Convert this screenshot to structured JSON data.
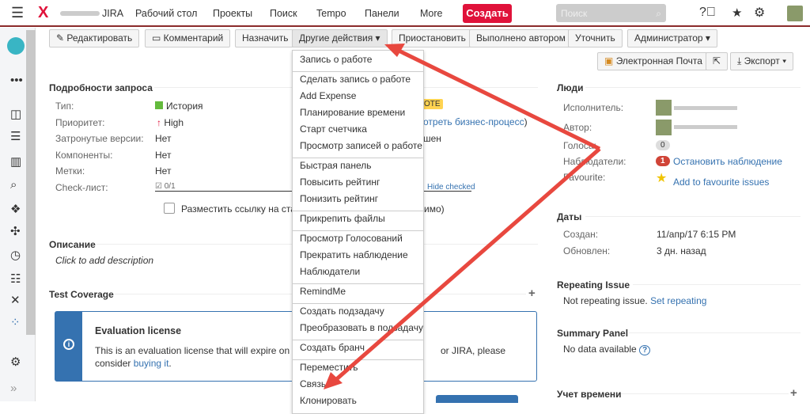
{
  "header": {
    "app": "JIRA",
    "nav": [
      "Рабочий стол",
      "Проекты",
      "Поиск",
      "Tempo",
      "Панели",
      "More"
    ],
    "create": "Создать",
    "search_placeholder": "Поиск"
  },
  "toolbar": {
    "edit": "Редактировать",
    "comment": "Комментарий",
    "assign": "Назначить",
    "more": "Другие действия",
    "pause": "Приостановить",
    "done_by_author": "Выполнено автором",
    "clarify": "Уточнить",
    "admin": "Администратор",
    "email": "Электронная Почта",
    "export": "Экспорт"
  },
  "details": {
    "title": "Подробности запроса",
    "rows": [
      {
        "label": "Тип:",
        "value": "История"
      },
      {
        "label": "Приоритет:",
        "value": "High"
      },
      {
        "label": "Затронутые версии:",
        "value": "Нет"
      },
      {
        "label": "Компоненты:",
        "value": "Нет"
      },
      {
        "label": "Метки:",
        "value": "Нет"
      },
      {
        "label": "Check-лист:",
        "value": "0/1"
      }
    ],
    "status_badge": "OTE",
    "workflow_link": "отреть бизнес-процесс",
    "workflow_paren": ")",
    "resolution": "шен",
    "hide_checked": "Hide checked",
    "checkbox_label": "Разместить ссылку на стат",
    "checkbox_tail": "имо)"
  },
  "description": {
    "title": "Описание",
    "placeholder": "Click to add description"
  },
  "test_coverage": {
    "title": "Test Coverage",
    "license_title": "Evaluation license",
    "license_text": "This is an evaluation license that will expire on 20",
    "license_text2": "or JIRA, please",
    "license_text3": "consider ",
    "buy_link": "buying it",
    "period": "."
  },
  "menu": {
    "groups": [
      [
        "Запись о работе"
      ],
      [
        "Сделать запись о работе",
        "Add Expense",
        "Планирование времени",
        "Старт счетчика",
        "Просмотр записей о работе"
      ],
      [
        "Быстрая панель",
        "Повысить рейтинг",
        "Понизить рейтинг"
      ],
      [
        "Прикрепить файлы"
      ],
      [
        "Просмотр Голосований",
        "Прекратить наблюдение",
        "Наблюдатели"
      ],
      [
        "RemindMe"
      ],
      [
        "Создать подзадачу",
        "Преобразовать в подзадачу"
      ],
      [
        "Создать бранч"
      ],
      [
        "Переместить",
        "Связь",
        "Клонировать"
      ]
    ]
  },
  "people": {
    "title": "Люди",
    "assignee": "Исполнитель:",
    "author": "Автор:",
    "votes": "Голоса:",
    "votes_count": "0",
    "watchers": "Наблюдатели:",
    "watchers_count": "1",
    "stop_watching": "Остановить наблюдение",
    "favourite": "Favourite:",
    "add_fav": "Add to favourite issues"
  },
  "dates": {
    "title": "Даты",
    "created_label": "Создан:",
    "created": "11/апр/17 6:15 PM",
    "updated_label": "Обновлен:",
    "updated": "3 дн. назад"
  },
  "repeating": {
    "title": "Repeating Issue",
    "text": "Not repeating issue. ",
    "link": "Set repeating"
  },
  "summary": {
    "title": "Summary Panel",
    "text": "No data available"
  },
  "time": {
    "title": "Учет времени"
  },
  "colors": {
    "accent": "#3572b0",
    "create": "#e0123a",
    "arrow": "#e8483f"
  }
}
